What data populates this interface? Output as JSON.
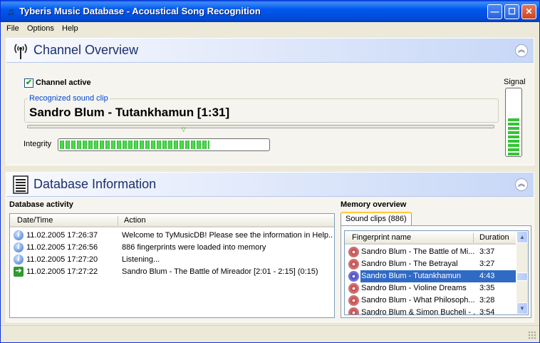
{
  "window": {
    "title": "Tyberis Music Database - Acoustical Song Recognition",
    "minimize": "—",
    "maximize": "☐",
    "close": "✕"
  },
  "menu": {
    "file": "File",
    "options": "Options",
    "help": "Help"
  },
  "channel_panel": {
    "title": "Channel Overview",
    "collapse": "︽",
    "checkbox_label": "Channel active",
    "checkbox_checked": true,
    "recognized_legend": "Recognized sound clip",
    "recognized_value": "Sandro Blum - Tutankhamun [1:31]",
    "position_fraction": 0.33,
    "integrity_label": "Integrity",
    "integrity_fraction": 0.72,
    "signal_label": "Signal",
    "signal_level_bars": 9
  },
  "database_panel": {
    "title": "Database Information",
    "collapse": "︽",
    "activity_label": "Database activity",
    "columns": [
      "Date/Time",
      "Action"
    ],
    "rows": [
      {
        "icon": "info-icon",
        "datetime": "11.02.2005 17:26:37",
        "action": "Welcome to TyMusicDB! Please see the information in Help..."
      },
      {
        "icon": "info-icon",
        "datetime": "11.02.2005 17:26:56",
        "action": "886 fingerprints were loaded into memory"
      },
      {
        "icon": "info-icon",
        "datetime": "11.02.2005 17:27:20",
        "action": "Listening..."
      },
      {
        "icon": "arrow-right-icon",
        "datetime": "11.02.2005 17:27:22",
        "action": "Sandro Blum - The Battle of Mireador [2:01 - 2:15] (0:15)"
      }
    ],
    "memory_label": "Memory overview",
    "tab_label": "Sound clips (886)",
    "memory_columns": [
      "Fingerprint name",
      "Duration"
    ],
    "memory_rows": [
      {
        "name": "Sandro Blum - The Battle of Mi...",
        "duration": "3:37",
        "selected": false
      },
      {
        "name": "Sandro Blum - The Betrayal",
        "duration": "3:27",
        "selected": false
      },
      {
        "name": "Sandro Blum - Tutankhamun",
        "duration": "4:43",
        "selected": true
      },
      {
        "name": "Sandro Blum - Violine Dreams",
        "duration": "3:35",
        "selected": false
      },
      {
        "name": "Sandro Blum - What Philosoph...",
        "duration": "3:28",
        "selected": false
      },
      {
        "name": "Sandro Blum & Simon Bucheli - ...",
        "duration": "3:54",
        "selected": false
      }
    ],
    "scroll_up": "▲",
    "scroll_down": "▼"
  }
}
